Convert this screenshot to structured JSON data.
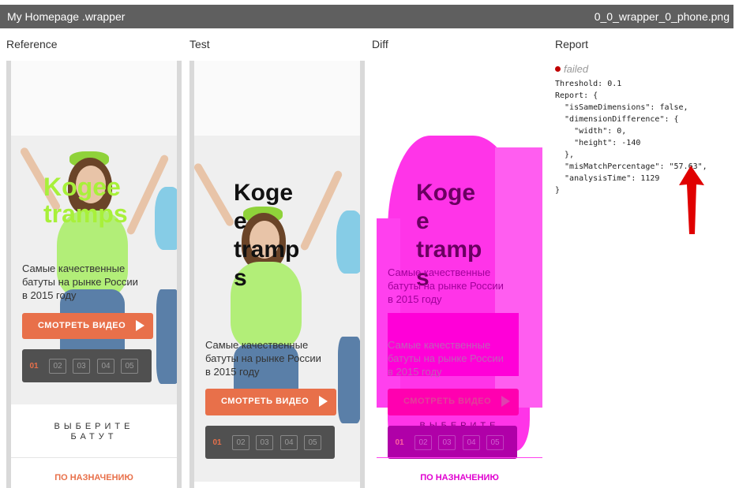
{
  "header": {
    "title": "My Homepage .wrapper",
    "filename": "0_0_wrapper_0_phone.png"
  },
  "columns": {
    "reference": "Reference",
    "test": "Test",
    "diff": "Diff",
    "report": "Report"
  },
  "site": {
    "logo_reference_lines": [
      "Kogee",
      "tramps"
    ],
    "logo_test_lines": [
      "Koge",
      "e",
      "tramp",
      "s"
    ],
    "subtitle_lines": [
      "Самые качественные",
      "батуты на рынке России",
      "в 2015 году"
    ],
    "video_button": "СМОТРЕТЬ ВИДЕО",
    "pages": [
      "01",
      "02",
      "03",
      "04",
      "05"
    ],
    "choose_line1": "ВЫБЕРИТЕ",
    "choose_line2": "БАТУТ",
    "purpose_link": "ПО НАЗНАЧЕНИЮ"
  },
  "report": {
    "status": "failed",
    "text": "Threshold: 0.1\nReport: {\n  \"isSameDimensions\": false,\n  \"dimensionDifference\": {\n    \"width\": 0,\n    \"height\": -140\n  },\n  \"misMatchPercentage\": \"57.63\",\n  \"analysisTime\": 1129\n}"
  },
  "colors": {
    "accent": "#e8704a",
    "logo_reference": "#a8f03a",
    "diff_magenta": "#ff00ff",
    "status_failed": "#c00000",
    "arrow": "#e00000"
  }
}
